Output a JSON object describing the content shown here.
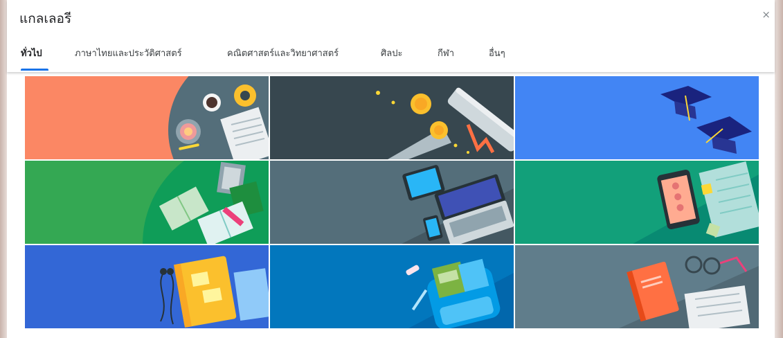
{
  "dialog": {
    "title": "แกลเลอรี",
    "close_label": "×"
  },
  "tabs": [
    {
      "label": "ทั่วไป",
      "active": true
    },
    {
      "label": "ภาษาไทยและประวัติศาสตร์",
      "active": false
    },
    {
      "label": "คณิตศาสตร์และวิทยาศาสตร์",
      "active": false
    },
    {
      "label": "ศิลปะ",
      "active": false
    },
    {
      "label": "กีฬา",
      "active": false
    },
    {
      "label": "อื่นๆ",
      "active": false
    }
  ],
  "colors": {
    "accent": "#1a73e8",
    "tile_coffee": "#fb8764",
    "tile_graduation_scroll": "#37474f",
    "tile_graduation_caps": "#4285f4",
    "tile_books": "#34a853",
    "tile_laptop": "#546e7a",
    "tile_phone_notes": "#12a07a",
    "tile_notebook_headphones": "#3367d6",
    "tile_backpack": "#0277bd",
    "tile_glasses_book": "#607d8b"
  },
  "gallery": [
    {
      "name": "gallery-tile-coffee-newspaper",
      "motif": "coffee-cup-newspaper",
      "color": "#fb8764"
    },
    {
      "name": "gallery-tile-diploma-coins",
      "motif": "diploma-coins",
      "color": "#37474f"
    },
    {
      "name": "gallery-tile-graduation-caps",
      "motif": "graduation-caps",
      "color": "#4285f4"
    },
    {
      "name": "gallery-tile-books",
      "motif": "open-books",
      "color": "#34a853"
    },
    {
      "name": "gallery-tile-laptop-tablet",
      "motif": "laptop-tablet-phone",
      "color": "#546e7a"
    },
    {
      "name": "gallery-tile-phone-notes",
      "motif": "phone-notebook",
      "color": "#12a07a"
    },
    {
      "name": "gallery-tile-notebook-headphones",
      "motif": "notebook-headphones",
      "color": "#3367d6"
    },
    {
      "name": "gallery-tile-backpack",
      "motif": "backpack-pencils",
      "color": "#0277bd"
    },
    {
      "name": "gallery-tile-glasses-book",
      "motif": "book-glasses-newspaper",
      "color": "#607d8b"
    }
  ]
}
